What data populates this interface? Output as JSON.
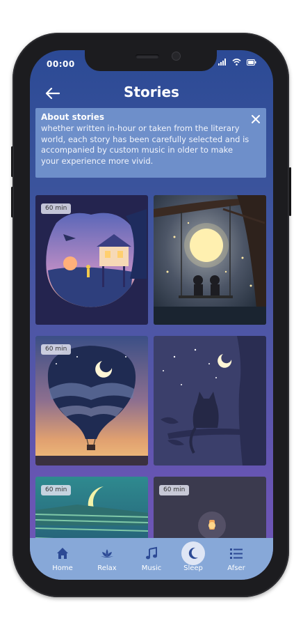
{
  "status_bar": {
    "time": "00:00"
  },
  "header": {
    "title": "Stories"
  },
  "info_banner": {
    "title": "About stories",
    "text": "whether written in-hour or taken from the literary world, each story has been carefully selected and is accompanied by custom music in older to make your experience more vivid."
  },
  "stories": [
    {
      "duration": "60 min",
      "scene": "tree-house"
    },
    {
      "duration": "",
      "scene": "moon-swing"
    },
    {
      "duration": "60 min",
      "scene": "balloon-sky"
    },
    {
      "duration": "",
      "scene": "cat-on-branch"
    },
    {
      "duration": "60 min",
      "scene": "crescent-moon-field"
    },
    {
      "duration": "60 min",
      "scene": "lantern"
    }
  ],
  "bottom_nav": {
    "active": "Sleep",
    "items": [
      {
        "label": "Home",
        "icon": "home-icon"
      },
      {
        "label": "Relax",
        "icon": "lotus-icon"
      },
      {
        "label": "Music",
        "icon": "music-note-icon"
      },
      {
        "label": "Sleep",
        "icon": "moon-icon"
      },
      {
        "label": "Afser",
        "icon": "list-icon"
      }
    ]
  }
}
